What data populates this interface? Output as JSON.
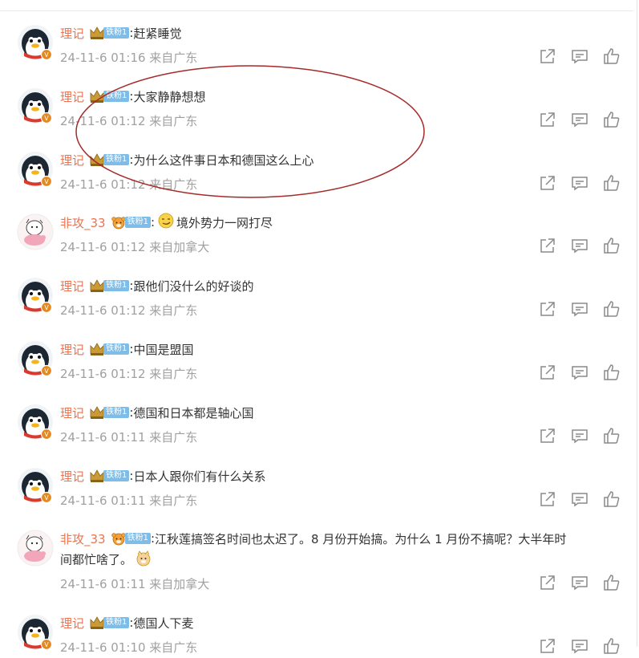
{
  "comments": [
    {
      "user": "理记",
      "badge": "铁粉1",
      "avatar": "penguin-avatar",
      "prefix": ":",
      "text": "赶紧睡觉",
      "time": "24-11-6 01:16 来自广东"
    },
    {
      "user": "理记",
      "badge": "铁粉1",
      "avatar": "penguin-avatar",
      "prefix": ":",
      "text": "大家静静想想",
      "time": "24-11-6 01:12 来自广东"
    },
    {
      "user": "理记",
      "badge": "铁粉1",
      "avatar": "penguin-avatar",
      "prefix": ":",
      "text": "为什么这件事日本和德国这么上心",
      "time": "24-11-6 01:12 来自广东"
    },
    {
      "user": "非攻_33",
      "badge": "铁粉1",
      "avatar": "cartoon-avatar",
      "prefix": ":",
      "emoji": "smirk-emoji",
      "text": "境外势力一网打尽",
      "time": "24-11-6 01:12 来自加拿大"
    },
    {
      "user": "理记",
      "badge": "铁粉1",
      "avatar": "penguin-avatar",
      "prefix": ":",
      "text": "跟他们没什么的好谈的",
      "time": "24-11-6 01:12 来自广东"
    },
    {
      "user": "理记",
      "badge": "铁粉1",
      "avatar": "penguin-avatar",
      "prefix": ":",
      "text": "中国是盟国",
      "time": "24-11-6 01:12 来自广东"
    },
    {
      "user": "理记",
      "badge": "铁粉1",
      "avatar": "penguin-avatar",
      "prefix": ":",
      "text": "德国和日本都是轴心国",
      "time": "24-11-6 01:11 来自广东"
    },
    {
      "user": "理记",
      "badge": "铁粉1",
      "avatar": "penguin-avatar",
      "prefix": ":",
      "text": "日本人跟你们有什么关系",
      "time": "24-11-6 01:11 来自广东"
    },
    {
      "user": "非攻_33",
      "badge": "铁粉1",
      "avatar": "cartoon-avatar",
      "prefix": ":",
      "text": "江秋莲搞签名时间也太迟了。8 月份开始搞。为什么 1 月份不搞呢？大半年时",
      "text2": "间都忙啥了。",
      "emoji2": "doge-emoji",
      "time": "24-11-6 01:11 来自加拿大"
    },
    {
      "user": "理记",
      "badge": "铁粉1",
      "avatar": "penguin-avatar",
      "prefix": ":",
      "text": "德国人下麦",
      "time": "24-11-6 01:10 来自广东"
    }
  ],
  "icons": {
    "share": "share-icon",
    "comment": "comment-icon",
    "like": "like-icon"
  },
  "colors": {
    "username": "#eb7350",
    "badge": "#7fbde9",
    "annotation": "#a52a2a"
  }
}
